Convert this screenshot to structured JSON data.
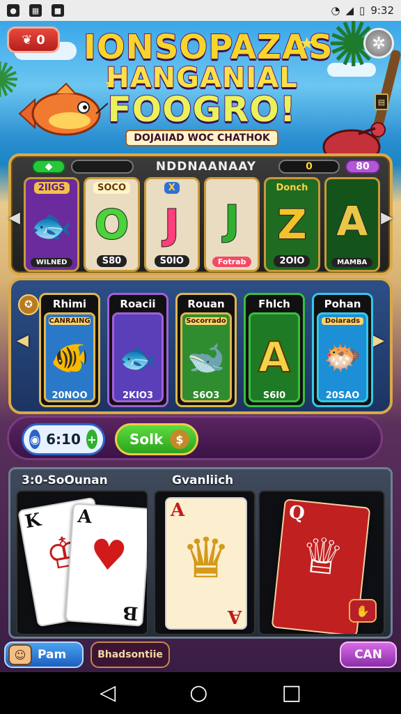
{
  "status_bar": {
    "time": "9:32",
    "left_icons": [
      "notification-icon",
      "image-icon",
      "square-icon"
    ],
    "right_icons": [
      "wifi-icon",
      "signal-icon",
      "battery-icon"
    ]
  },
  "header": {
    "lives_value": "0",
    "title_line1": "IONSOPAZAS",
    "title_line2": "HANGANIAL",
    "title_line3": "FOOGRO!",
    "subtitle": "DOJAIIAD WOC CHATHOK"
  },
  "slot": {
    "top_name": "NDDNAANAAY",
    "top_value": "0",
    "top_right": "80",
    "reels": [
      {
        "label": "2IIGS",
        "symbol": "fish",
        "value": "WILNED",
        "bg": "#6b2b9c"
      },
      {
        "label": "SOCO",
        "symbol": "O",
        "value": "S80",
        "bg": "#e9dcc0"
      },
      {
        "label": "X",
        "symbol": "J",
        "value": "S0IO",
        "bg": "#e9dcc0"
      },
      {
        "label": "",
        "symbol": "J",
        "value": "Fotrab",
        "bg": "#e9dcc0"
      },
      {
        "label": "Donch",
        "symbol": "Z",
        "value": "2OIO",
        "bg": "#1f6b22"
      },
      {
        "label": "",
        "symbol": "A",
        "value": "MAMBA",
        "bg": "#14541b"
      }
    ]
  },
  "fish_cards": [
    {
      "title": "Rhimi",
      "banner": "CANRAING",
      "value": "20NOO",
      "art_bg": "#2a78c8",
      "border": "#e1b64c"
    },
    {
      "title": "Roacii",
      "banner": "",
      "value": "2KIO3",
      "art_bg": "#5a3fb8",
      "border": "#a25fd8"
    },
    {
      "title": "Rouan",
      "banner": "Socorrado",
      "value": "S6O3",
      "art_bg": "#2f8d2f",
      "border": "#e1b64c"
    },
    {
      "title": "Fhlch",
      "banner": "",
      "value": "S6I0",
      "art_bg": "#1f7a25",
      "border": "#38c03c"
    },
    {
      "title": "Pohan",
      "banner": "Doiarads",
      "value": "20SAO",
      "art_bg": "#1c8fd6",
      "border": "#36c7e8"
    }
  ],
  "controls": {
    "bet_value": "6:10",
    "spin_label": "Solk"
  },
  "cards": {
    "left_label": "3:0-SoOunan",
    "mid_label": "Gvanliich"
  },
  "bottom": {
    "pam_label": "Pam",
    "bs_label": "Bhadsontiie",
    "can_label": "CAN"
  }
}
